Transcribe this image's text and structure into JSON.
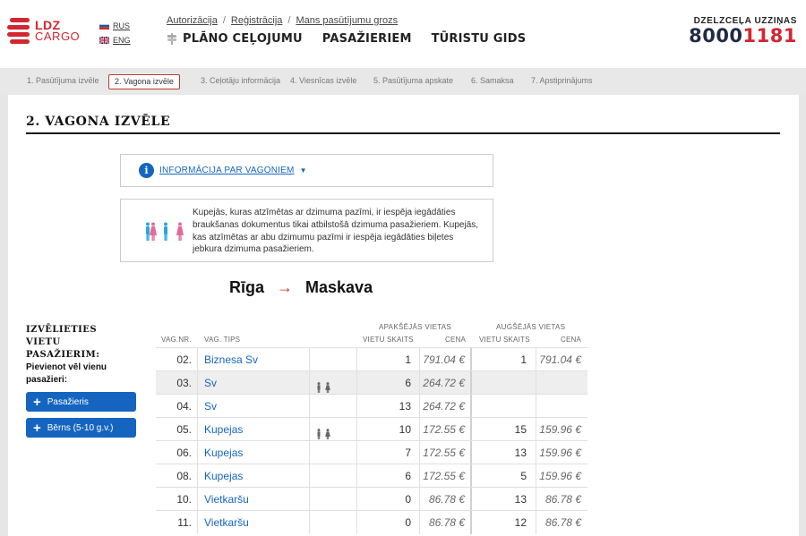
{
  "header": {
    "logo_line1": "LDZ",
    "logo_line2": "CARGO",
    "languages": [
      {
        "code": "RUS"
      },
      {
        "code": "ENG"
      }
    ],
    "top_links": [
      "Autorizācija",
      "Reģistrācija",
      "Mans pasūtījumu grozs"
    ],
    "nav": [
      "PLĀNO CEĻOJUMU",
      "PASAŽIERIEM",
      "TŪRISTU GIDS"
    ],
    "hotline_label": "DZELZCEĻA UZZIŅAS",
    "hotline_number_dark": "8000",
    "hotline_number_red": "1181"
  },
  "steps": [
    "1. Pasūtījuma izvēle",
    "2. Vagona izvēle",
    "3. Ceļotāju informācija",
    "4. Viesnīcas izvēle",
    "5. Pasūtījuma apskate",
    "6. Samaksa",
    "7. Apstiprinājums"
  ],
  "active_step": 1,
  "page_title": "2. VAGONA IZVĒLE",
  "info_link": "INFORMĀCIJA PAR VAGONIEM",
  "notice": "Kupejās, kuras atzīmētas ar dzimuma pazīmi, ir iespēja iegādāties braukšanas dokumentus tikai atbilstošā dzimuma pasažieriem. Kupejās, kas atzīmētas ar abu dzimumu pazīmi ir iespēja iegādāties biļetes jebkura dzimuma pasažieriem.",
  "route": {
    "from": "Rīga",
    "arrow": "→",
    "to": "Maskava"
  },
  "left_panel": {
    "choose_title": "IZVĒLIETIES VIETU PASAŽIERIM:",
    "add_label": "Pievienot vēl vienu pasažieri:",
    "add_passenger": "Pasažieris",
    "add_child": "Bērns (5-10 g.v.)"
  },
  "table": {
    "group_lower": "APAKŠĒJĀS VIETAS",
    "group_upper": "AUGŠĒJĀS VIETAS",
    "col_num": "VAG.NR.",
    "col_type": "VAG. TIPS",
    "col_lower_seats": "VIETU SKAITS",
    "col_lower_price": "CENA",
    "col_upper_seats": "VIETU SKAITS",
    "col_upper_price": "CENA",
    "rows": [
      {
        "num": "02.",
        "type": "Biznesa Sv",
        "gender": false,
        "low_seats": "1",
        "low_price": "791.04 €",
        "up_seats": "1",
        "up_price": "791.04 €"
      },
      {
        "num": "03.",
        "type": "Sv",
        "gender": true,
        "low_seats": "6",
        "low_price": "264.72 €",
        "up_seats": "",
        "up_price": ""
      },
      {
        "num": "04.",
        "type": "Sv",
        "gender": false,
        "low_seats": "13",
        "low_price": "264.72 €",
        "up_seats": "",
        "up_price": ""
      },
      {
        "num": "05.",
        "type": "Kupejas",
        "gender": true,
        "low_seats": "10",
        "low_price": "172.55 €",
        "up_seats": "15",
        "up_price": "159.96 €"
      },
      {
        "num": "06.",
        "type": "Kupejas",
        "gender": false,
        "low_seats": "7",
        "low_price": "172.55 €",
        "up_seats": "13",
        "up_price": "159.96 €"
      },
      {
        "num": "08.",
        "type": "Kupejas",
        "gender": false,
        "low_seats": "6",
        "low_price": "172.55 €",
        "up_seats": "5",
        "up_price": "159.96 €"
      },
      {
        "num": "10.",
        "type": "Vietkaršu",
        "gender": false,
        "low_seats": "0",
        "low_price": "86.78 €",
        "up_seats": "13",
        "up_price": "86.78 €"
      },
      {
        "num": "11.",
        "type": "Vietkaršu",
        "gender": false,
        "low_seats": "0",
        "low_price": "86.78 €",
        "up_seats": "12",
        "up_price": "86.78 €"
      }
    ]
  },
  "colors": {
    "brand_red": "#d22630",
    "link_blue": "#1565c0",
    "hotline_dark": "#1f2a44"
  }
}
